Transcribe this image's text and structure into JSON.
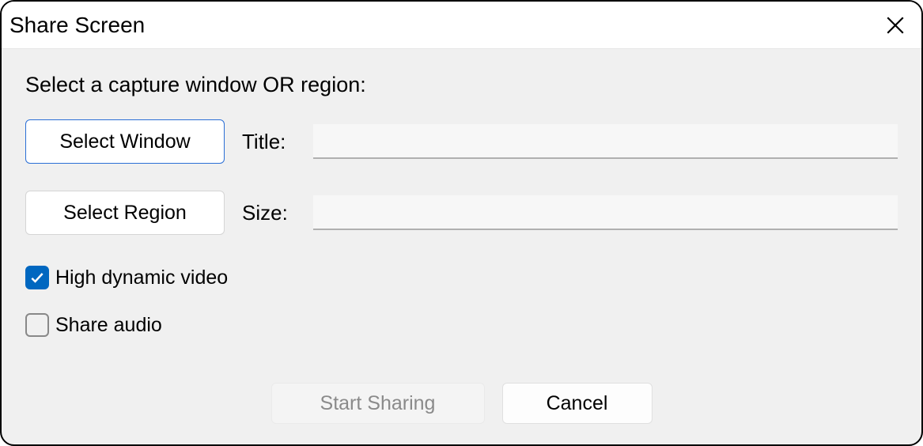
{
  "titlebar": {
    "title": "Share Screen"
  },
  "instruction": "Select a capture window OR region:",
  "rows": {
    "window": {
      "button": "Select Window",
      "label": "Title:",
      "value": ""
    },
    "region": {
      "button": "Select Region",
      "label": "Size:",
      "value": ""
    }
  },
  "checks": {
    "hdv": {
      "label": "High dynamic video",
      "checked": true
    },
    "audio": {
      "label": "Share audio",
      "checked": false
    }
  },
  "footer": {
    "start": "Start Sharing",
    "cancel": "Cancel"
  },
  "colors": {
    "accent": "#0067c0"
  }
}
